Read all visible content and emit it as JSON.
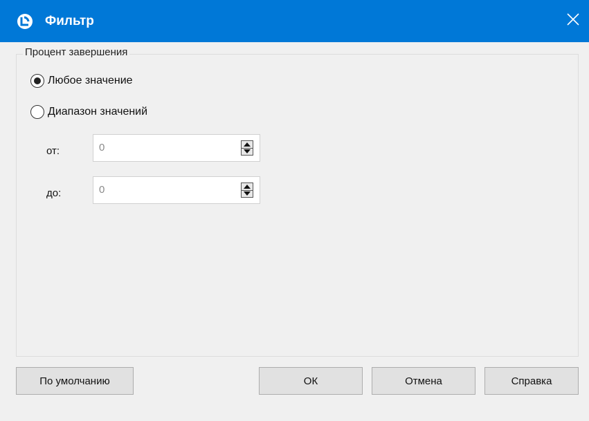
{
  "window": {
    "title": "Фильтр",
    "accent": "#0078d7"
  },
  "group": {
    "title": "Процент завершения"
  },
  "options": {
    "any_value": {
      "label": "Любое значение",
      "selected": true
    },
    "range": {
      "label": "Диапазон значений",
      "selected": false
    }
  },
  "range": {
    "from_label": "от:",
    "from_value": "0",
    "to_label": "до:",
    "to_value": "0"
  },
  "buttons": {
    "default_label": "По умолчанию",
    "ok_label": "ОК",
    "cancel_label": "Отмена",
    "help_label": "Справка"
  },
  "icons": {
    "app": "app-logo-icon",
    "close": "close-icon"
  }
}
